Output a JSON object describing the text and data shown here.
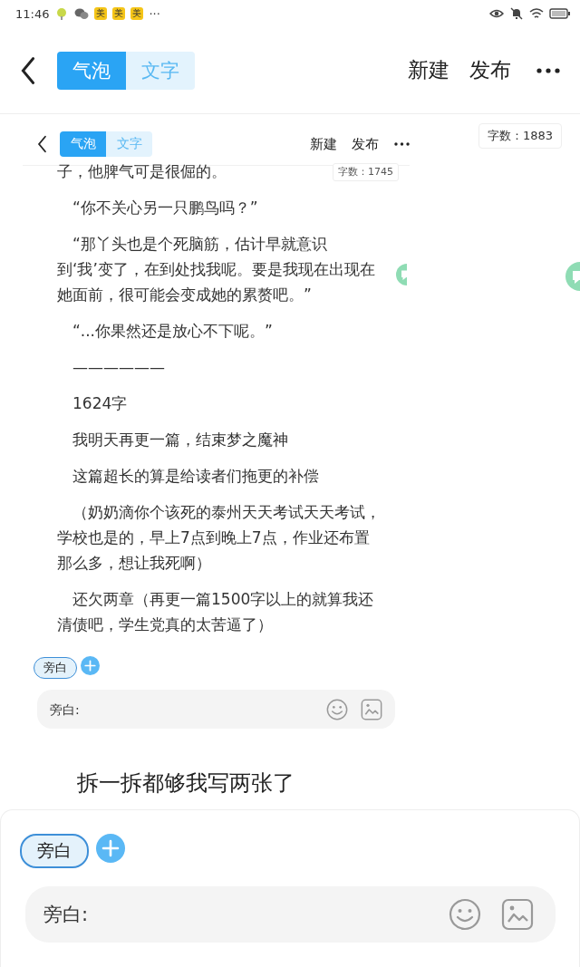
{
  "status_bar": {
    "time": "11:46",
    "badges": [
      "美",
      "美",
      "美"
    ],
    "more": "···"
  },
  "top_bar": {
    "tabs": [
      {
        "label": "气泡",
        "selected": true
      },
      {
        "label": "文字",
        "selected": false
      }
    ],
    "actions": [
      "新建",
      "发布"
    ]
  },
  "word_count": "字数：1883",
  "screenshot": {
    "tabs": [
      {
        "label": "气泡",
        "selected": true
      },
      {
        "label": "文字",
        "selected": false
      }
    ],
    "actions": [
      "新建",
      "发布"
    ],
    "word_count": "字数：1745",
    "paragraphs": [
      {
        "text": "子，他脾气可是很倔的。",
        "continued": true
      },
      {
        "text": "“你不关心另一只鹏鸟吗？”",
        "continued": false
      },
      {
        "text": "“那丫头也是个死脑筋，估计早就意识到‘我’变了，在到处找我呢。要是我现在出现在她面前，很可能会变成她的累赘吧。”",
        "continued": false
      },
      {
        "text": "“...你果然还是放心不下呢。”",
        "continued": false
      },
      {
        "text": "——————",
        "continued": false
      },
      {
        "text": "1624字",
        "continued": false
      },
      {
        "text": "我明天再更一篇，结束梦之魔神",
        "continued": false
      },
      {
        "text": "这篇超长的算是给读者们拖更的补偿",
        "continued": false
      },
      {
        "text": "（奶奶滴你个该死的泰州天天考试天天考试，学校也是的，早上7点到晚上7点，作业还布置那么多，想让我死啊）",
        "continued": false
      },
      {
        "text": "还欠两章（再更一篇1500字以上的就算我还清债吧，学生党真的太苦逼了）",
        "continued": false
      }
    ],
    "tag": {
      "label": "旁白",
      "selected": true
    },
    "input": {
      "placeholder": "旁白:"
    }
  },
  "caption": "拆一拆都够我写两张了",
  "composer": {
    "tag": {
      "label": "旁白",
      "selected": true
    },
    "input": {
      "placeholder": "旁白:"
    }
  }
}
